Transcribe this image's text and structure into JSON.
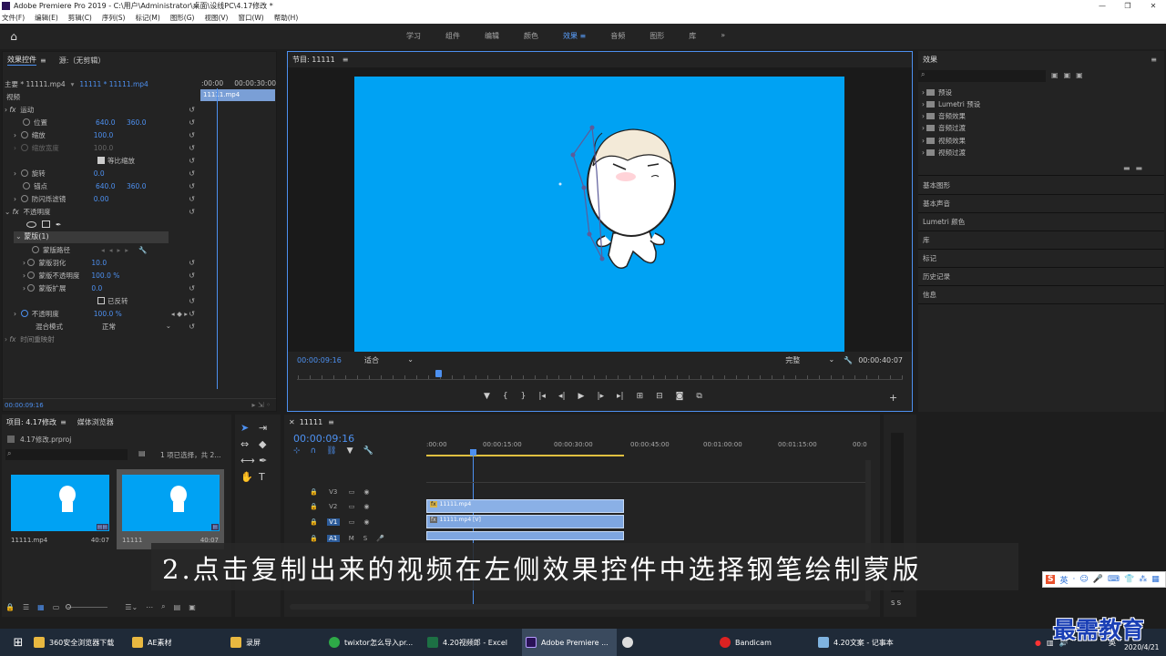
{
  "window": {
    "title": "Adobe Premiere Pro 2019 - C:\\用户\\Administrator\\桌面\\设线PC\\4.17修改 *"
  },
  "menu": [
    "文件(F)",
    "编辑(E)",
    "剪辑(C)",
    "序列(S)",
    "标记(M)",
    "图形(G)",
    "视图(V)",
    "窗口(W)",
    "帮助(H)"
  ],
  "workspaces": [
    {
      "label": "学习"
    },
    {
      "label": "组件"
    },
    {
      "label": "编辑"
    },
    {
      "label": "颜色"
    },
    {
      "label": "效果"
    },
    {
      "label": "音频"
    },
    {
      "label": "图形"
    },
    {
      "label": "库"
    }
  ],
  "effect_controls": {
    "tab": "效果控件",
    "tab2": "源:（无剪辑）",
    "master": "主要 * 11111.mp4",
    "sequence": "11111 * 11111.mp4",
    "time_start": ":00:00",
    "time_end": "00:00:30:00",
    "clip": "11111.mp4",
    "video_label": "视频",
    "motion": "运动",
    "position": "位置",
    "pos_x": "640.0",
    "pos_y": "360.0",
    "scale": "缩放",
    "scale_v": "100.0",
    "scale_w": "缩放宽度",
    "scale_w_v": "100.0",
    "uniform": "等比缩放",
    "rotation": "旋转",
    "rotation_v": "0.0",
    "anchor": "锚点",
    "anchor_x": "640.0",
    "anchor_y": "360.0",
    "flicker": "防闪烁滤镜",
    "flicker_v": "0.00",
    "opacity_group": "不透明度",
    "mask": "蒙版(1)",
    "mask_path": "蒙版路径",
    "mask_feather": "蒙版羽化",
    "mask_feather_v": "10.0",
    "mask_opacity": "蒙版不透明度",
    "mask_opacity_v": "100.0 %",
    "mask_expand": "蒙版扩展",
    "mask_expand_v": "0.0",
    "inverted": "已反转",
    "opacity": "不透明度",
    "opacity_v": "100.0 %",
    "blend": "混合模式",
    "blend_v": "正常",
    "remap": "时间重映射",
    "timecode": "00:00:09:16"
  },
  "program": {
    "title": "节目: 11111",
    "timecode": "00:00:09:16",
    "fit": "适合",
    "quality": "完整",
    "duration": "00:00:40:07",
    "video_color": "#00a2f3"
  },
  "effects": {
    "title": "效果",
    "folders": [
      "预设",
      "Lumetri 预设",
      "音频效果",
      "音频过渡",
      "视频效果",
      "视频过渡"
    ],
    "panels": [
      "基本图形",
      "基本声音",
      "Lumetri 颜色",
      "库",
      "标记",
      "历史记录",
      "信息"
    ]
  },
  "project": {
    "tab": "项目: 4.17修改",
    "tab2": "媒体浏览器",
    "file": "4.17修改.prproj",
    "selection": "1 项已选择，共 2...",
    "items": [
      {
        "name": "11111.mp4",
        "dur": "40:07"
      },
      {
        "name": "11111",
        "dur": "40:07"
      }
    ]
  },
  "timeline": {
    "title": "11111",
    "timecode": "00:00:09:16",
    "ruler": [
      ":00:00",
      "00:00:15:00",
      "00:00:30:00",
      "00:00:45:00",
      "00:01:00:00",
      "00:01:15:00",
      "00:0"
    ],
    "tracks": [
      "V3",
      "V2",
      "V1",
      "A1"
    ],
    "clip_v2": "11111.mp4",
    "clip_v1": "11111.mp4 [V]"
  },
  "caption": "2.点击复制出来的视频在左侧效果控件中选择钢笔绘制蒙版",
  "taskbar": {
    "items": [
      "360安全浏览器下载",
      "AE素材",
      "录屏",
      "twixtor怎么导入pr...",
      "4.20视频郎 - Excel",
      "Adobe Premiere ...",
      "",
      "Bandicam",
      "4.20文案 - 记事本"
    ],
    "lang": "英",
    "date": "2020/4/21"
  },
  "watermark": "最需教育",
  "ime": [
    "英",
    "·",
    "☺",
    "🎤",
    "⌨",
    "👕",
    "⁂",
    "▦"
  ]
}
